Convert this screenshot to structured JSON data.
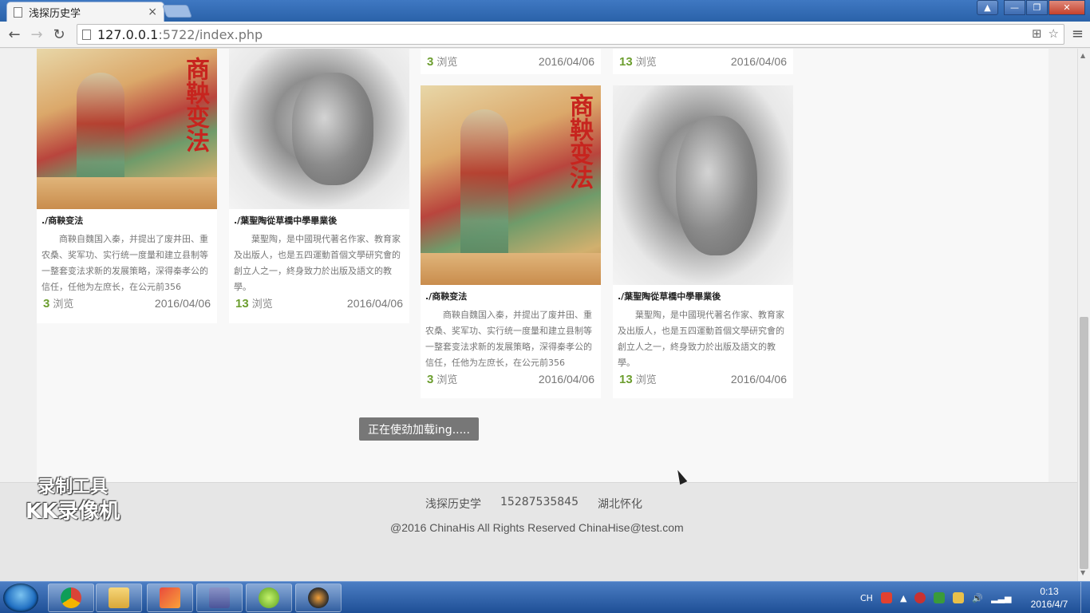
{
  "browser": {
    "tab_title": "浅探历史学",
    "url_host": "127.0.0.1",
    "url_rest": ":5722/index.php"
  },
  "cards": [
    {
      "title": "./商鞅变法",
      "desc": "商鞅自魏国入秦，并提出了废井田、重农桑、奖军功、实行统一度量和建立县制等一整套变法求新的发展策略，深得秦孝公的信任，任他为左庶长，在公元前356",
      "views": "3",
      "views_label": "浏览",
      "date": "2016/04/06"
    },
    {
      "title": "./葉聖陶從草橋中學畢業後",
      "desc": "葉聖陶，是中國現代著名作家、教育家及出版人，也是五四運動首個文學研究會的創立人之一，終身致力於出版及語文的教學。",
      "views": "13",
      "views_label": "浏览",
      "date": "2016/04/06"
    },
    {
      "title": "./商鞅变法",
      "desc": "商鞅自魏国入秦，并提出了废井田、重农桑、奖军功、实行统一度量和建立县制等一整套变法求新的发展策略，深得秦孝公的信任，任他为左庶长，在公元前356",
      "views": "3",
      "views_label": "浏览",
      "date": "2016/04/06"
    },
    {
      "title": "./葉聖陶從草橋中學畢業後",
      "desc": "葉聖陶，是中國現代著名作家、教育家及出版人，也是五四運動首個文學研究會的創立人之一，終身致力於出版及語文的教學。",
      "views": "13",
      "views_label": "浏览",
      "date": "2016/04/06"
    }
  ],
  "top_cards": [
    {
      "views": "3",
      "views_label": "浏览",
      "date": "2016/04/06"
    },
    {
      "views": "13",
      "views_label": "浏览",
      "date": "2016/04/06"
    }
  ],
  "pic_text": "商鞅变法",
  "loading_text": "正在使劲加载ing.....",
  "footer": {
    "site_name": "浅探历史学",
    "phone": "15287535845",
    "location": "湖北怀化",
    "copyright": "@2016 ChinaHis All Rights Reserved ChinaHise@test.com"
  },
  "watermark": {
    "line1": "录制工具",
    "line2": "KK录像机"
  },
  "tray": {
    "lang": "CH"
  },
  "clock": {
    "time": "0:13",
    "date": "2016/4/7"
  },
  "colors": {
    "accent_green": "#6c9e2f",
    "loading_bg": "#777777",
    "titlebar": "#2a62a9"
  }
}
